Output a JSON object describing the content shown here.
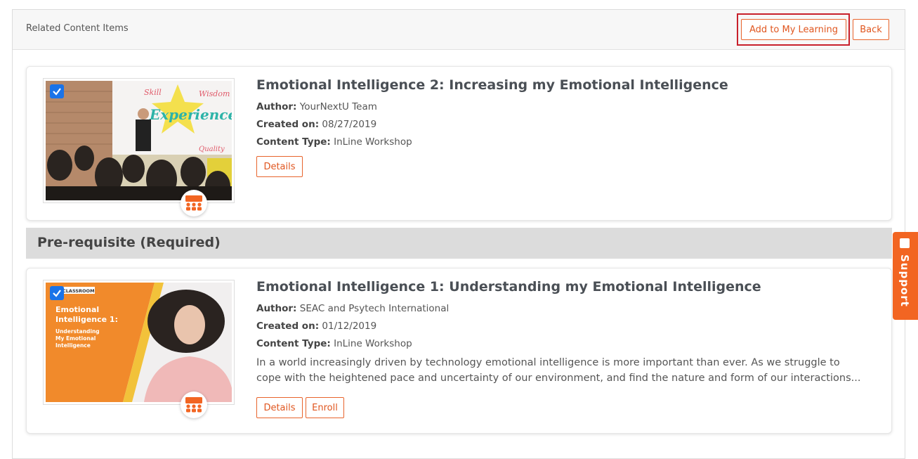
{
  "header": {
    "title": "Related Content Items",
    "add_button": "Add to My Learning",
    "back_button": "Back"
  },
  "section": {
    "title": "Pre-requisite (Required)"
  },
  "items": [
    {
      "title": "Emotional Intelligence 2: Increasing my Emotional Intelligence",
      "author_label": "Author:",
      "author": "YourNextU Team",
      "created_label": "Created on:",
      "created": "08/27/2019",
      "type_label": "Content Type:",
      "type": "InLine Workshop",
      "details_button": "Details",
      "thumb_words": [
        "Skill",
        "Wisdom",
        "Experience",
        "Quality"
      ]
    },
    {
      "title": "Emotional Intelligence 1: Understanding my Emotional Intelligence",
      "author_label": "Author:",
      "author": "SEAC and Psytech International",
      "created_label": "Created on:",
      "created": "01/12/2019",
      "type_label": "Content Type:",
      "type": "InLine Workshop",
      "description_line1": "In a world increasingly driven by technology emotional intelligence is more important than ever. As we struggle to",
      "description_line2": "cope with the heightened pace and uncertainty of our environment, and find the nature and form of our interactions...",
      "details_button": "Details",
      "enroll_button": "Enroll",
      "thumb_tag": "CLASSROOM",
      "thumb_title": "Emotional Intelligence 1:",
      "thumb_subtitle": "Understanding My Emotional Intelligence"
    }
  ],
  "support": {
    "label": "Support"
  },
  "colors": {
    "accent": "#e8642c",
    "support_tab": "#f26522",
    "checkbox": "#1a73e8",
    "highlight": "#c8202b",
    "section_bar": "#dcdcdc"
  }
}
